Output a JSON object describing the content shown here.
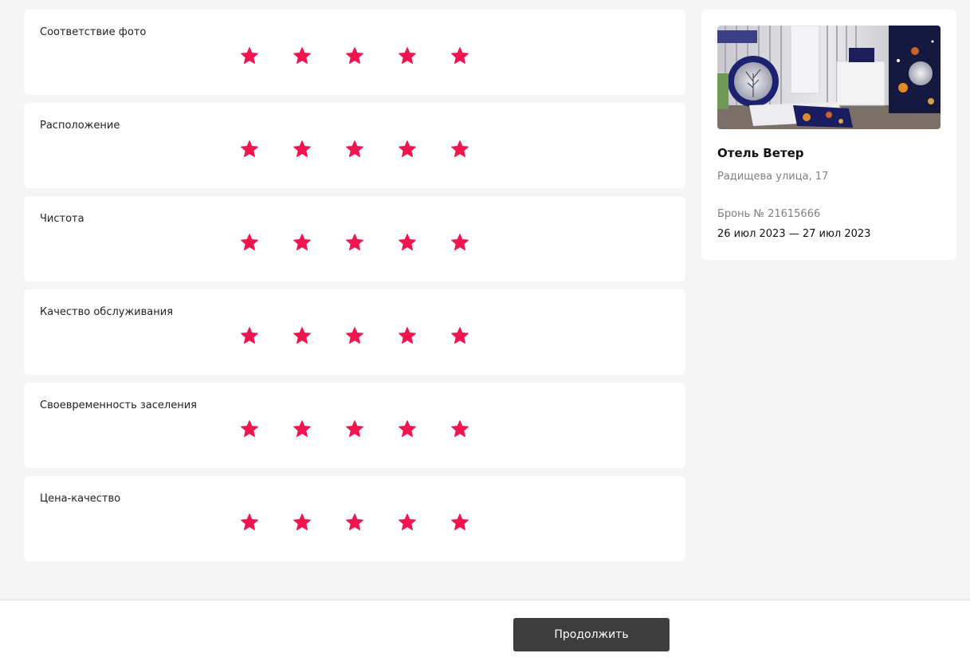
{
  "accent_color": "#f0144f",
  "ratings": [
    {
      "label": "Соответствие фото",
      "value": 5,
      "max": 5
    },
    {
      "label": "Расположение",
      "value": 5,
      "max": 5
    },
    {
      "label": "Чистота",
      "value": 5,
      "max": 5
    },
    {
      "label": "Качество обслуживания",
      "value": 5,
      "max": 5
    },
    {
      "label": "Своевременность заселения",
      "value": 5,
      "max": 5
    },
    {
      "label": "Цена-качество",
      "value": 5,
      "max": 5
    }
  ],
  "hotel": {
    "name": "Отель Ветер",
    "address": "Радищева улица, 17",
    "booking_number": "Бронь № 21615666",
    "dates": "26 июл 2023 — 27 июл 2023"
  },
  "footer": {
    "continue_label": "Продолжить"
  }
}
